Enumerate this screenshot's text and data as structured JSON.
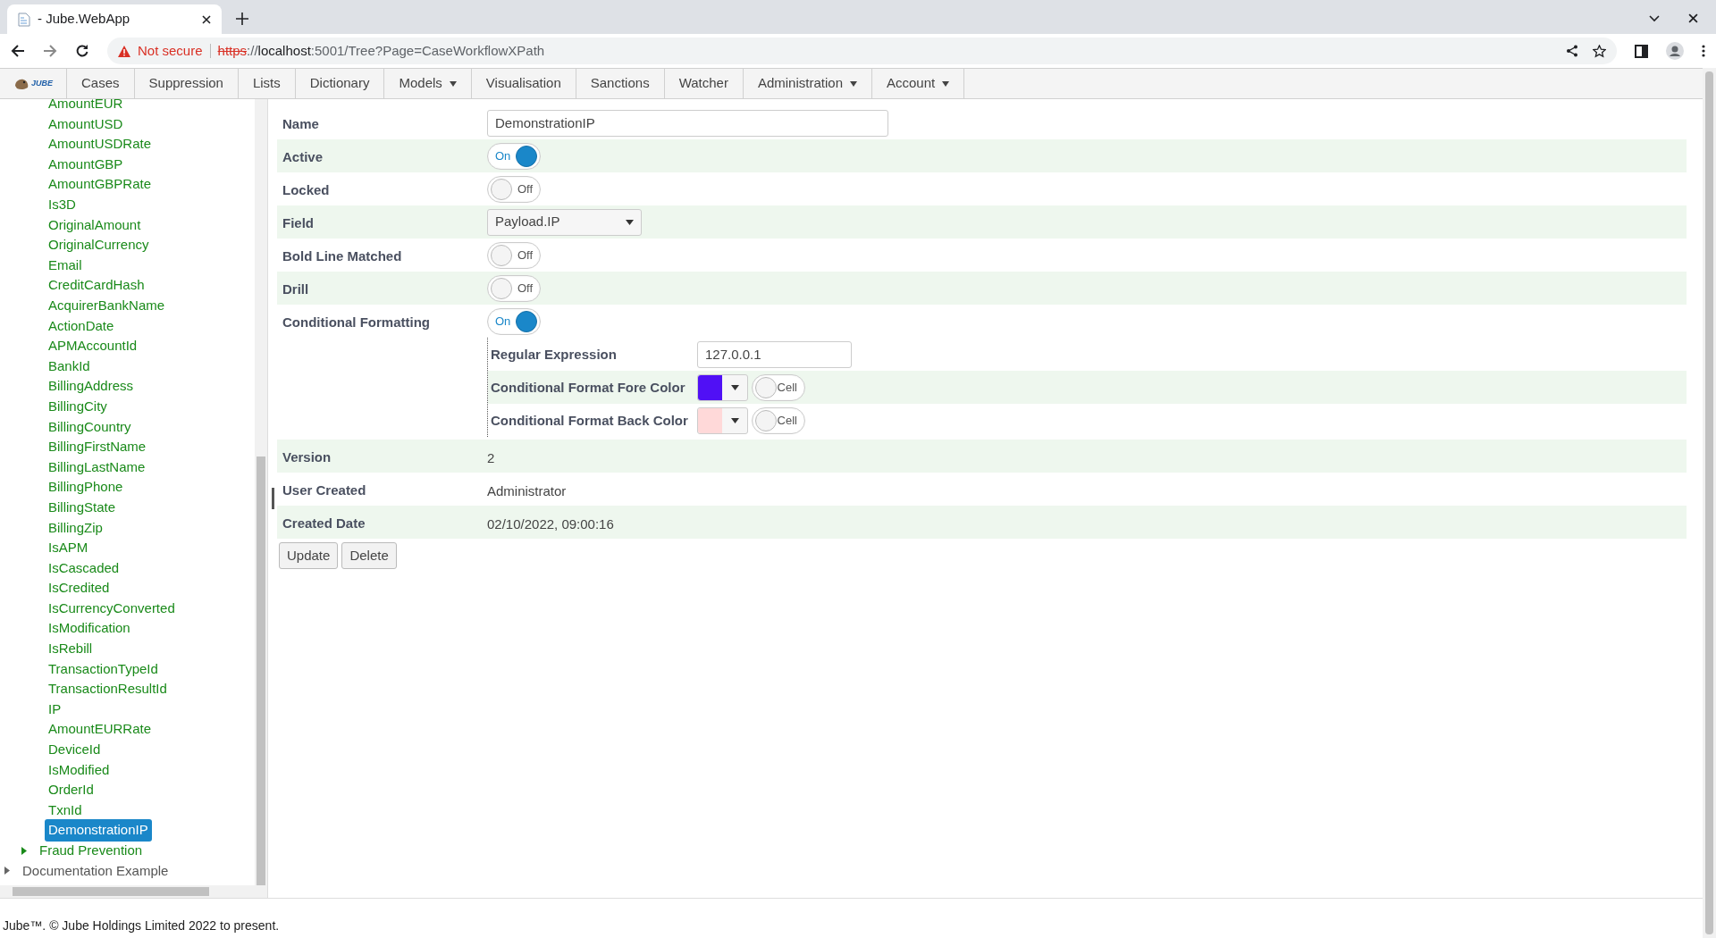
{
  "browser": {
    "tab_title": "- Jube.WebApp",
    "security": "Not secure",
    "url": {
      "scheme": "https",
      "separator": "://",
      "host": "localhost",
      "path": ":5001/Tree?Page=CaseWorkflowXPath"
    }
  },
  "nav": {
    "logo": "JUBE",
    "items": [
      {
        "label": "Cases",
        "dropdown": false
      },
      {
        "label": "Suppression",
        "dropdown": false
      },
      {
        "label": "Lists",
        "dropdown": false
      },
      {
        "label": "Dictionary",
        "dropdown": false
      },
      {
        "label": "Models",
        "dropdown": true
      },
      {
        "label": "Visualisation",
        "dropdown": false
      },
      {
        "label": "Sanctions",
        "dropdown": false
      },
      {
        "label": "Watcher",
        "dropdown": false
      },
      {
        "label": "Administration",
        "dropdown": true
      },
      {
        "label": "Account",
        "dropdown": true
      }
    ]
  },
  "tree": {
    "nodes": [
      {
        "children": [
          {
            "children": [
              {
                "label": "AmountEUR",
                "selected": false
              },
              {
                "label": "AmountUSD",
                "selected": false
              },
              {
                "label": "AmountUSDRate",
                "selected": false
              },
              {
                "label": "AmountGBP",
                "selected": false
              },
              {
                "label": "AmountGBPRate",
                "selected": false
              },
              {
                "label": "Is3D",
                "selected": false
              },
              {
                "label": "OriginalAmount",
                "selected": false
              },
              {
                "label": "OriginalCurrency",
                "selected": false
              },
              {
                "label": "Email",
                "selected": false
              },
              {
                "label": "CreditCardHash",
                "selected": false
              },
              {
                "label": "AcquirerBankName",
                "selected": false
              },
              {
                "label": "ActionDate",
                "selected": false
              },
              {
                "label": "APMAccountId",
                "selected": false
              },
              {
                "label": "BankId",
                "selected": false
              },
              {
                "label": "BillingAddress",
                "selected": false
              },
              {
                "label": "BillingCity",
                "selected": false
              },
              {
                "label": "BillingCountry",
                "selected": false
              },
              {
                "label": "BillingFirstName",
                "selected": false
              },
              {
                "label": "BillingLastName",
                "selected": false
              },
              {
                "label": "BillingPhone",
                "selected": false
              },
              {
                "label": "BillingState",
                "selected": false
              },
              {
                "label": "BillingZip",
                "selected": false
              },
              {
                "label": "IsAPM",
                "selected": false
              },
              {
                "label": "IsCascaded",
                "selected": false
              },
              {
                "label": "IsCredited",
                "selected": false
              },
              {
                "label": "IsCurrencyConverted",
                "selected": false
              },
              {
                "label": "IsModification",
                "selected": false
              },
              {
                "label": "IsRebill",
                "selected": false
              },
              {
                "label": "TransactionTypeId",
                "selected": false
              },
              {
                "label": "TransactionResultId",
                "selected": false
              },
              {
                "label": "IP",
                "selected": false
              },
              {
                "label": "AmountEURRate",
                "selected": false
              },
              {
                "label": "DeviceId",
                "selected": false
              },
              {
                "label": "IsModified",
                "selected": false
              },
              {
                "label": "OrderId",
                "selected": false
              },
              {
                "label": "TxnId",
                "selected": false
              },
              {
                "label": "DemonstrationIP",
                "selected": true
              }
            ]
          },
          {
            "label": "Fraud Prevention",
            "expanded": false
          }
        ]
      },
      {
        "label": "Documentation Example",
        "expanded": false
      }
    ]
  },
  "form": {
    "rows": [
      {
        "kind": "text",
        "label": "Name",
        "value": "DemonstrationIP"
      },
      {
        "kind": "toggle",
        "label": "Active",
        "on": true,
        "text": "On"
      },
      {
        "kind": "toggle",
        "label": "Locked",
        "on": false,
        "text": "Off"
      },
      {
        "kind": "select",
        "label": "Field",
        "value": "Payload.IP"
      },
      {
        "kind": "toggle",
        "label": "Bold Line Matched",
        "on": false,
        "text": "Off"
      },
      {
        "kind": "toggle",
        "label": "Drill",
        "on": false,
        "text": "Off"
      },
      {
        "kind": "toggle",
        "label": "Conditional Formatting",
        "on": true,
        "text": "On",
        "sub_rows": [
          {
            "kind": "text",
            "label": "Regular Expression",
            "value": "127.0.0.1"
          },
          {
            "kind": "color",
            "label": "Conditional Format Fore Color",
            "color": "#5010f5",
            "cell": {
              "on": false,
              "text": "Cell"
            }
          },
          {
            "kind": "color",
            "label": "Conditional Format Back Color",
            "color": "#ffd9d9",
            "cell": {
              "on": false,
              "text": "Cell"
            }
          }
        ]
      },
      {
        "kind": "readonly",
        "label": "Version",
        "value": "2"
      },
      {
        "kind": "readonly",
        "label": "User Created",
        "value": "Administrator"
      },
      {
        "kind": "readonly",
        "label": "Created Date",
        "value": "02/10/2022, 09:00:16"
      }
    ],
    "buttons": [
      "Update",
      "Delete"
    ]
  },
  "footer": "Jube™. © Jube Holdings Limited 2022 to present."
}
